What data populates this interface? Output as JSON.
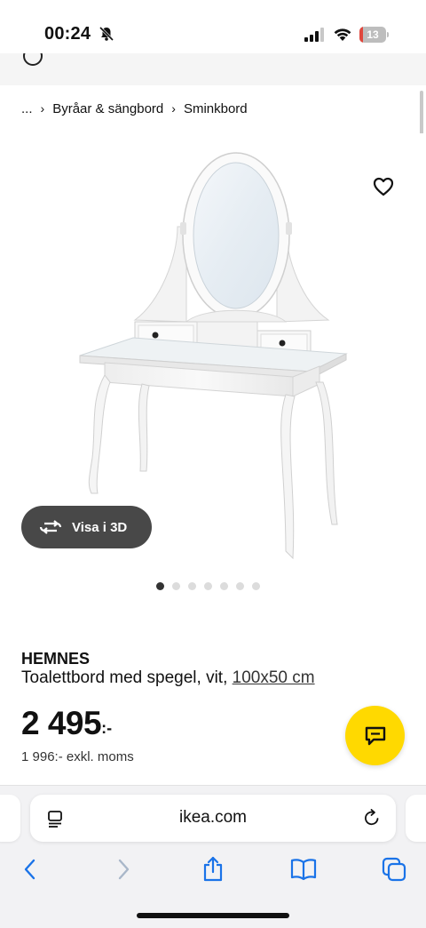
{
  "status_bar": {
    "time": "00:24",
    "battery_level": "13",
    "battery_fraction": 0.13,
    "icons": [
      "bell-slash-icon",
      "cellular-signal-icon",
      "wifi-icon",
      "battery-icon"
    ]
  },
  "breadcrumb": {
    "items": [
      "...",
      "Byråar & sängbord",
      "Sminkbord"
    ]
  },
  "gallery": {
    "view_3d_label": "Visa i 3D",
    "dot_count": 7,
    "active_dot": 1
  },
  "product": {
    "name": "HEMNES",
    "description": "Toalettbord med spegel, vit,",
    "size": "100x50 cm",
    "price": "2 495",
    "price_suffix": ":-",
    "price_excl_vat": "1 996:- exkl. moms"
  },
  "browser": {
    "url": "ikea.com"
  },
  "colors": {
    "chat_button": "#ffd900",
    "view_3d_button": "#484848",
    "active_dot": "#333333",
    "battery_low": "#e0473d"
  }
}
